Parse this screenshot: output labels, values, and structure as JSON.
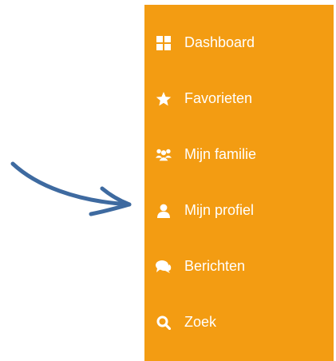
{
  "colors": {
    "sidebar_background": "#f39c12",
    "text": "#ffffff",
    "arrow": "#3e6aa0"
  },
  "menu": {
    "items": [
      {
        "label": "Dashboard",
        "icon": "dashboard-icon"
      },
      {
        "label": "Favorieten",
        "icon": "star-icon"
      },
      {
        "label": "Mijn familie",
        "icon": "users-icon"
      },
      {
        "label": "Mijn profiel",
        "icon": "user-icon"
      },
      {
        "label": "Berichten",
        "icon": "comments-icon"
      },
      {
        "label": "Zoek",
        "icon": "search-icon"
      }
    ]
  }
}
